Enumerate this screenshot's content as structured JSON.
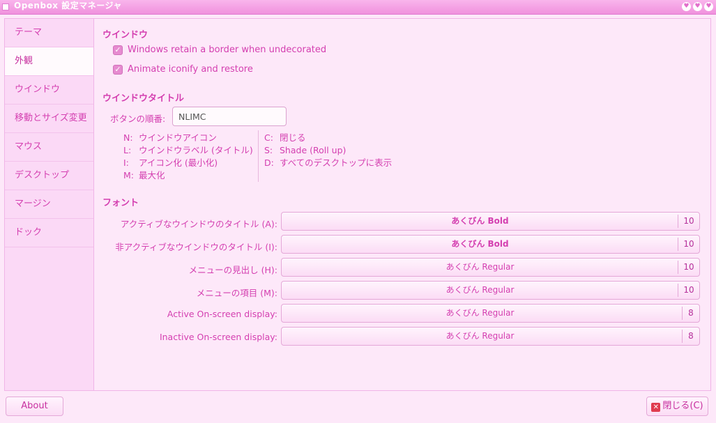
{
  "window": {
    "title": "Openbox 設定マネージャ",
    "buttons": [
      "♥",
      "♥",
      "♥"
    ]
  },
  "sidebar": {
    "items": [
      {
        "label": "テーマ"
      },
      {
        "label": "外観",
        "active": true
      },
      {
        "label": "ウインドウ"
      },
      {
        "label": "移動とサイズ変更"
      },
      {
        "label": "マウス"
      },
      {
        "label": "デスクトップ"
      },
      {
        "label": "マージン"
      },
      {
        "label": "ドック"
      }
    ]
  },
  "windows_section": {
    "title": "ウインドウ",
    "retain_border": {
      "label": "Windows retain a border when undecorated",
      "checked": true
    },
    "animate_iconify": {
      "label": "Animate iconify and restore",
      "checked": true
    }
  },
  "titlebar_section": {
    "title": "ウインドウタイトル",
    "order_label": "ボタンの順番:",
    "order_value": "NLIMC",
    "legend_left": [
      {
        "key": "N:",
        "text": "ウインドウアイコン"
      },
      {
        "key": "L:",
        "text": "ウインドウラベル (タイトル)"
      },
      {
        "key": "I:",
        "text": "アイコン化 (最小化)"
      },
      {
        "key": "M:",
        "text": "最大化"
      }
    ],
    "legend_right": [
      {
        "key": "C:",
        "text": "閉じる"
      },
      {
        "key": "S:",
        "text": "Shade (Roll up)"
      },
      {
        "key": "D:",
        "text": "すべてのデスクトップに表示"
      }
    ]
  },
  "font_section": {
    "title": "フォント",
    "fonts": [
      {
        "label": "アクティブなウインドウのタイトル (A):",
        "font": "あくびん Bold",
        "size": "10",
        "bold": true
      },
      {
        "label": "非アクティブなウインドウのタイトル (I):",
        "font": "あくびん Bold",
        "size": "10",
        "bold": true
      },
      {
        "label": "メニューの見出し (H):",
        "font": "あくびん Regular",
        "size": "10",
        "bold": false
      },
      {
        "label": "メニューの項目 (M):",
        "font": "あくびん Regular",
        "size": "10",
        "bold": false
      },
      {
        "label": "Active On-screen display:",
        "font": "あくびん Regular",
        "size": "8",
        "bold": false
      },
      {
        "label": "Inactive On-screen display:",
        "font": "あくびん Regular",
        "size": "8",
        "bold": false
      }
    ]
  },
  "footer": {
    "about_label": "About",
    "close_label": "閉じる(C)",
    "close_icon": "✕"
  },
  "colors": {
    "accent": "#d43fb0",
    "background": "#fde8f9",
    "titlebar": "#f091dd"
  }
}
